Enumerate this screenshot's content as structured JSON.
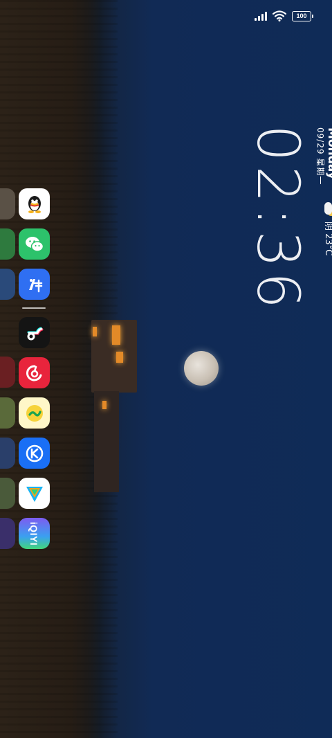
{
  "status_bar": {
    "battery_level": "100",
    "signal_icon": "cellular-signal-icon",
    "wifi_icon": "wifi-icon"
  },
  "clock_widget": {
    "time": "02:36",
    "weekday": "Monday",
    "date": "09/29 星期一",
    "weather_text": "阴 23°C",
    "weather_icon": "partly-cloudy-icon"
  },
  "dock": {
    "apps": [
      {
        "name": "QQ",
        "icon": "qq-penguin-icon",
        "color": "#ffffff"
      },
      {
        "name": "WeChat",
        "icon": "wechat-icon",
        "color": "#2dc26b"
      },
      {
        "name": "Zuoyebang",
        "icon": "pen-icon",
        "color": "#2f6ff2"
      },
      {
        "name": "TikTok",
        "icon": "tiktok-note-icon",
        "color": "#141414"
      },
      {
        "name": "NetEase Cloud Music",
        "icon": "music-icon",
        "color": "#e8243c"
      },
      {
        "name": "Sogou Input",
        "icon": "sogou-icon",
        "color": "#fff7c8"
      },
      {
        "name": "Kuaishou",
        "icon": "k-icon",
        "color": "#1a6ff5"
      },
      {
        "name": "Tencent Video",
        "icon": "play-triangle-icon",
        "color": "#ffffff"
      },
      {
        "name": "iQIYI",
        "icon": "iqiyi-icon",
        "label": "iQIYI",
        "color": "#7d5cf0"
      }
    ]
  }
}
